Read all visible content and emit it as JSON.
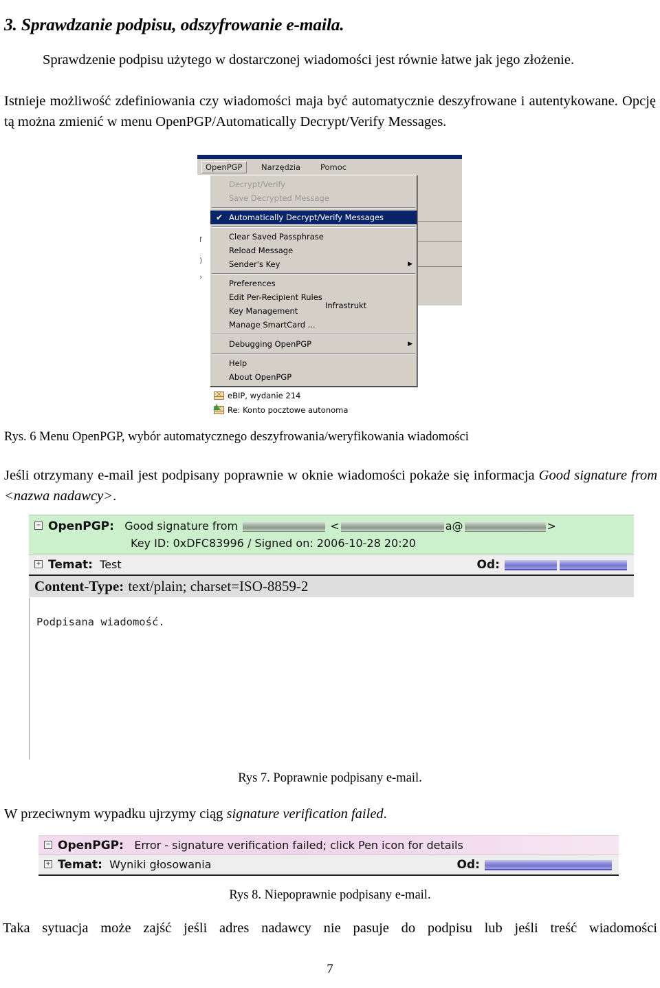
{
  "document": {
    "heading": "3. Sprawdzanie podpisu, odszyfrowanie e-maila.",
    "paragraph_1": "Sprawdzenie podpisu użytego w dostarczonej wiadomości jest równie łatwe jak jego złożenie.",
    "paragraph_2": "Istnieje możliwość zdefiniowania czy wiadomości maja być automatycznie deszyfrowane i autentykowane. Opcję tą można zmienić w menu OpenPGP/Automatically Decrypt/Verify Messages.",
    "caption_fig6": "Rys. 6   Menu OpenPGP, wybór automatycznego deszyfrowania/weryfikowania wiadomości",
    "paragraph_3_pre": "Jeśli otrzymany e-mail jest podpisany poprawnie w oknie wiadomości pokaże się informacja ",
    "paragraph_3_italic": "Good signature from <nazwa nadawcy>",
    "paragraph_3_post": ".",
    "caption_fig7": "Rys 7.  Poprawnie podpisany e-mail.",
    "paragraph_4_pre": "W przeciwnym wypadku ujrzymy ciąg ",
    "paragraph_4_italic": "signature verification failed",
    "paragraph_4_post": ".",
    "caption_fig8": "Rys 8.   Niepoprawnie podpisany e-mail.",
    "paragraph_5": "Taka sytuacja może zajść jeśli adres nadawcy nie pasuje do podpisu lub jeśli treść wiadomości",
    "page_number": "7"
  },
  "figure_menu": {
    "menubar": [
      {
        "label": "OpenPGP",
        "active": true
      },
      {
        "label": "Narzędzia",
        "active": false
      },
      {
        "label": "Pomoc",
        "active": false
      }
    ],
    "items": [
      {
        "label": "Decrypt/Verify",
        "state": "disabled",
        "check": "",
        "arrow": ""
      },
      {
        "label": "Save Decrypted Message",
        "state": "disabled",
        "check": "",
        "arrow": ""
      },
      {
        "separator": true
      },
      {
        "label": "Automatically Decrypt/Verify Messages",
        "state": "selected",
        "check": "✔",
        "arrow": ""
      },
      {
        "separator": true
      },
      {
        "label": "Clear Saved Passphrase",
        "state": "normal",
        "check": "",
        "arrow": ""
      },
      {
        "label": "Reload Message",
        "state": "normal",
        "check": "",
        "arrow": ""
      },
      {
        "label": "Sender's Key",
        "state": "normal",
        "check": "",
        "arrow": "▶"
      },
      {
        "separator": true
      },
      {
        "label": "Preferences",
        "state": "normal",
        "check": "",
        "arrow": ""
      },
      {
        "label": "Edit Per-Recipient Rules",
        "state": "normal",
        "check": "",
        "arrow": ""
      },
      {
        "label": "Key Management",
        "state": "normal",
        "check": "",
        "arrow": ""
      },
      {
        "label": "Manage SmartCard ...",
        "state": "normal",
        "check": "",
        "arrow": ""
      },
      {
        "separator": true
      },
      {
        "label": "Debugging OpenPGP",
        "state": "normal",
        "check": "",
        "arrow": "▶"
      },
      {
        "separator": true
      },
      {
        "label": "Help",
        "state": "normal",
        "check": "",
        "arrow": ""
      },
      {
        "label": "About OpenPGP",
        "state": "normal",
        "check": "",
        "arrow": ""
      }
    ],
    "background_text": "Infrastrukt",
    "mail_rows": [
      {
        "subject": "eBIP, wydanie 214",
        "icon": "envelope-icon"
      },
      {
        "subject": "Re: Konto pocztowe autonoma",
        "icon": "envelope-replied-icon"
      }
    ]
  },
  "figure_good": {
    "header_bg": "#ccf0cc",
    "openpgp_label": "OpenPGP:",
    "status_text": "Good signature from",
    "sender_redacted": "[redacted]",
    "key_line": "Key ID: 0xDFC83996 / Signed on: 2006-10-28 20:20",
    "subject_label": "Temat:",
    "subject_value": "Test",
    "from_label": "Od:",
    "from_redacted": "[redacted]",
    "content_type_key": "Content-Type:",
    "content_type_value": "text/plain; charset=ISO-8859-2",
    "body_text": "Podpisana wiadomość."
  },
  "figure_bad": {
    "header_bg": "#f0d8ee",
    "openpgp_label": "OpenPGP:",
    "status_text": "Error - signature verification failed; click Pen icon for details",
    "subject_label": "Temat:",
    "subject_value": "Wyniki głosowania",
    "from_label": "Od:",
    "from_redacted": "[redacted]"
  }
}
